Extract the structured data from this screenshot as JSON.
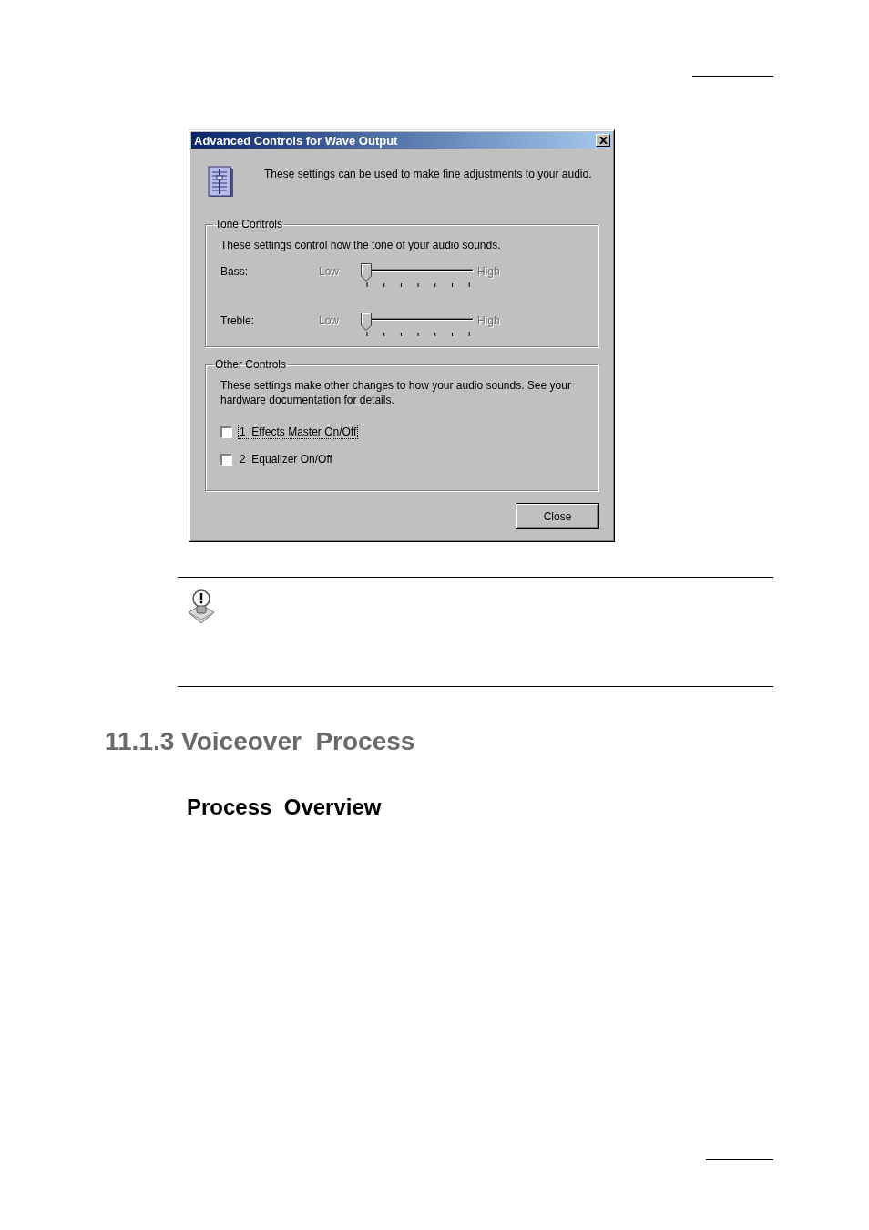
{
  "dialog": {
    "title": "Advanced Controls for Wave Output",
    "intro": "These settings can be used to make fine adjustments to your audio.",
    "tone_controls": {
      "legend": "Tone Controls",
      "description": "These settings control how the tone of your audio sounds.",
      "sliders": [
        {
          "label": "Bass:",
          "low": "Low",
          "high": "High",
          "disabled": true
        },
        {
          "label": "Treble:",
          "low": "Low",
          "high": "High",
          "disabled": true
        }
      ]
    },
    "other_controls": {
      "legend": "Other Controls",
      "description": "These settings make other changes to how your audio sounds.  See your hardware documentation for details.",
      "checkboxes": [
        {
          "label": "1  Effects Master On/Off",
          "checked": false,
          "focused": true
        },
        {
          "label": "2  Equalizer On/Off",
          "checked": false,
          "focused": false
        }
      ]
    },
    "buttons": [
      "Close"
    ]
  },
  "section_heading": "11.1.3 Voiceover  Process",
  "subsection_heading": "Process  Overview"
}
